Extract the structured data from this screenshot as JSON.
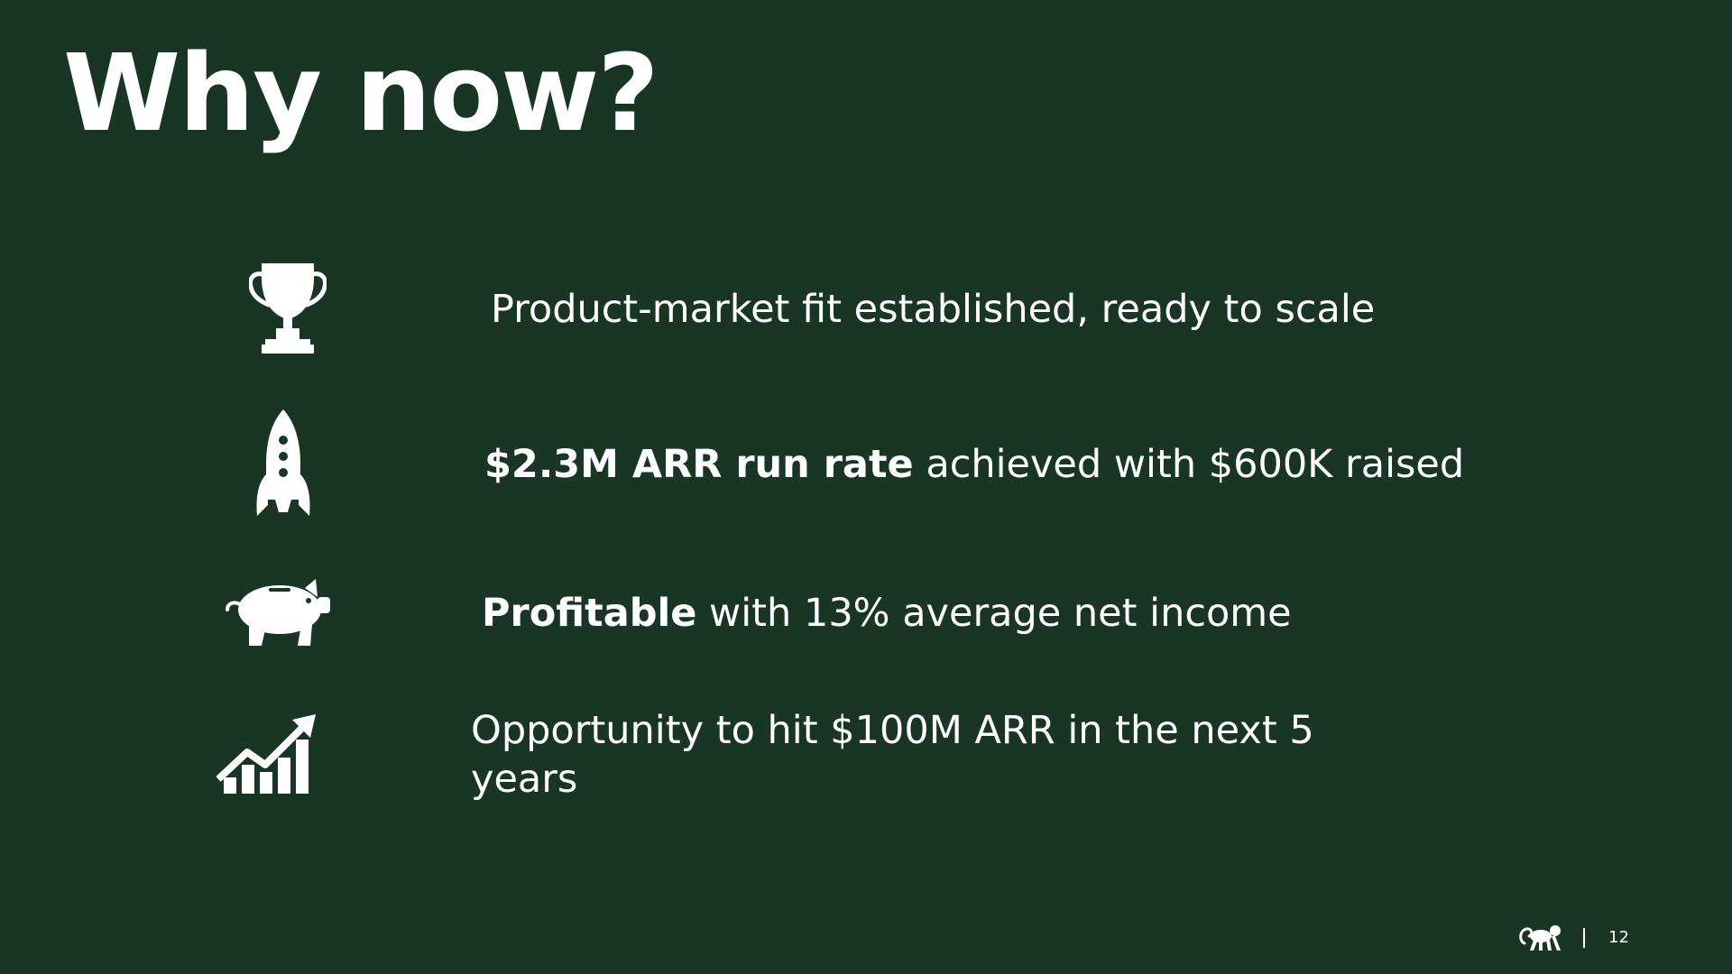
{
  "slide": {
    "title": "Why now?",
    "background_color": "#183526",
    "text_color": "#ffffff",
    "points": [
      {
        "icon": "trophy-icon",
        "bold": "",
        "text": "Product-market fit established, ready to scale"
      },
      {
        "icon": "rocket-icon",
        "bold": "$2.3M ARR run rate",
        "text": " achieved with $600K raised"
      },
      {
        "icon": "piggy-bank-icon",
        "bold": "Profitable",
        "text": " with 13% average net income"
      },
      {
        "icon": "growth-chart-icon",
        "bold": "",
        "text": "Opportunity to hit $100M ARR in the next 5 years"
      }
    ],
    "footer": {
      "logo_icon": "monkey-logo-icon",
      "page_number": "12"
    }
  }
}
